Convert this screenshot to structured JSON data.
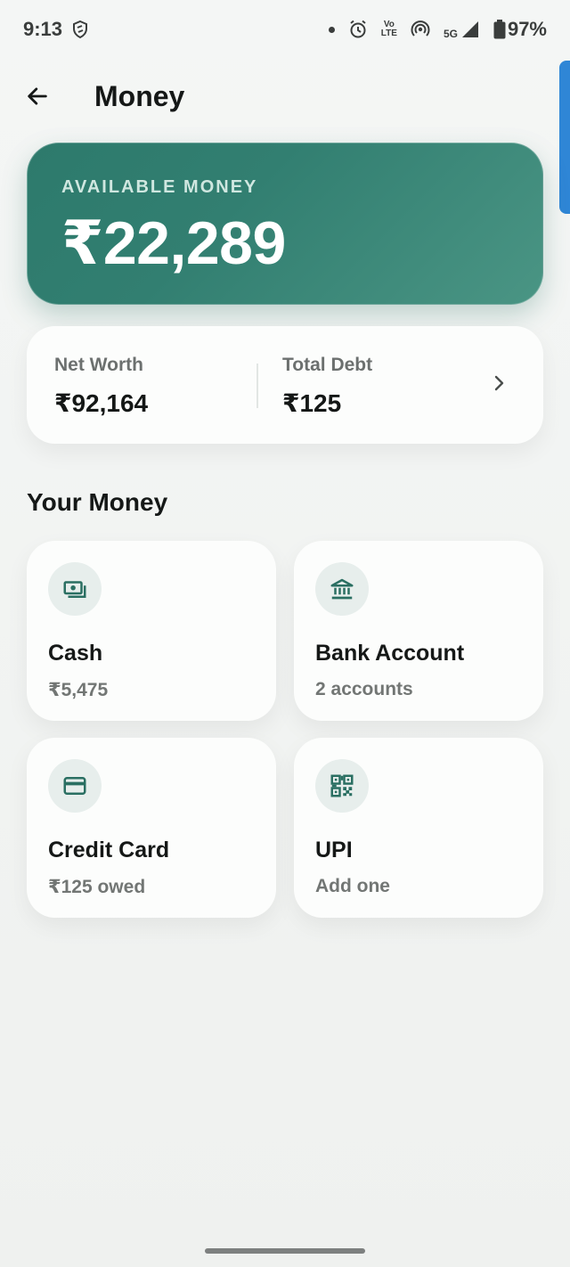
{
  "status_bar": {
    "time": "9:13",
    "volte_top": "Vo",
    "volte_bottom": "LTE",
    "network": "5G",
    "battery": "97%"
  },
  "header": {
    "title": "Money"
  },
  "available": {
    "label": "AVAILABLE MONEY",
    "amount": "₹22,289"
  },
  "summary": {
    "net_worth_label": "Net Worth",
    "net_worth_value": "₹92,164",
    "total_debt_label": "Total Debt",
    "total_debt_value": "₹125"
  },
  "section": {
    "title": "Your Money"
  },
  "tiles": [
    {
      "title": "Cash",
      "subtitle": "₹5,475",
      "icon": "cash-icon"
    },
    {
      "title": "Bank Account",
      "subtitle": "2 accounts",
      "icon": "bank-icon"
    },
    {
      "title": "Credit Card",
      "subtitle": "₹125 owed",
      "icon": "credit-card-icon"
    },
    {
      "title": "UPI",
      "subtitle": "Add one",
      "icon": "qr-code-icon"
    }
  ],
  "colors": {
    "accent": "#2d7a6c",
    "icon": "#2a6f62",
    "tile_icon_bg": "#e7eeec"
  }
}
